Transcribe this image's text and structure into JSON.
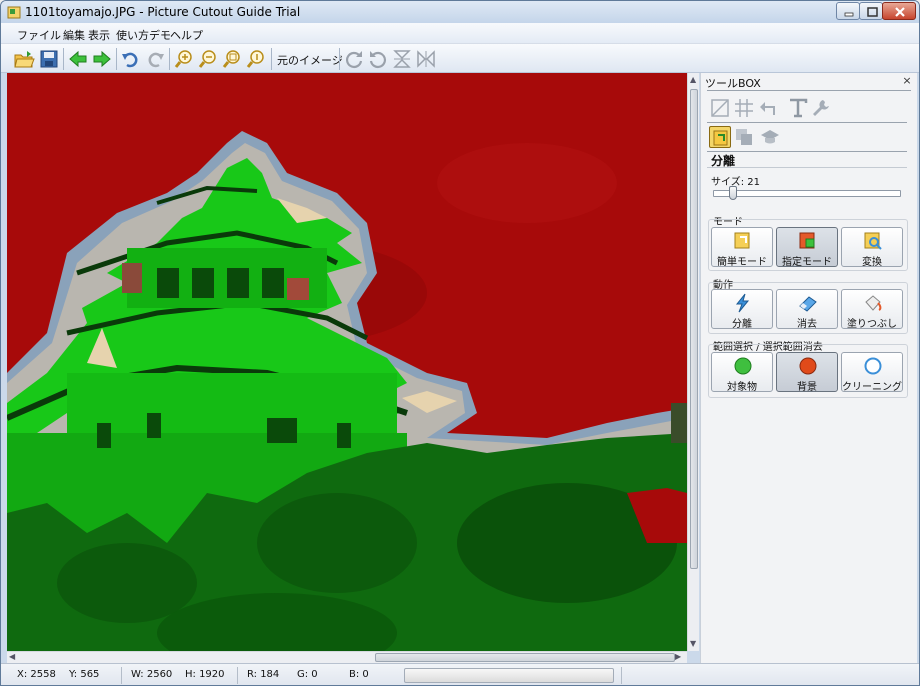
{
  "window": {
    "title": "1101toyamajo.JPG - Picture Cutout Guide Trial"
  },
  "menu": {
    "items": [
      "ファイル",
      "編集",
      "表示",
      "使い方デモ",
      "ヘルプ"
    ]
  },
  "toolbar": {
    "original_image_label": "元のイメージ",
    "icons": [
      "open-folder-icon",
      "save-icon",
      "back-arrow-icon",
      "forward-arrow-icon",
      "undo-icon",
      "redo-icon",
      "zoom-in-icon",
      "zoom-out-icon",
      "zoom-fit-icon",
      "zoom-actual-icon",
      "rotate-right-icon",
      "rotate-left-icon",
      "flip-vertical-icon",
      "flip-horizontal-icon"
    ]
  },
  "toolbox": {
    "title": "ツールBOX",
    "close_glyph": "×",
    "section_title": "分離",
    "size_label": "サイズ: 21",
    "size_value": 21,
    "mode": {
      "label": "モード",
      "buttons": [
        "簡単モード",
        "指定モード",
        "変換"
      ],
      "active": "指定モード"
    },
    "action": {
      "label": "動作",
      "buttons": [
        "分離",
        "消去",
        "塗りつぶし"
      ]
    },
    "range": {
      "label": "範囲選択 / 選択範囲消去",
      "buttons": [
        "対象物",
        "背景",
        "クリーニング"
      ],
      "active": "背景"
    },
    "colors": {
      "object_green": "#3fbf3f",
      "background_red": "#e04a1a",
      "cleaning_blue": "#3a8fd8"
    }
  },
  "canvas": {
    "overlay_colors": {
      "background": "#a70a0a",
      "object": "#18c818"
    }
  },
  "statusbar": {
    "x": "X: 2558",
    "y": "Y: 565",
    "w": "W: 2560",
    "h": "H: 1920",
    "r": "R: 184",
    "g": "G: 0",
    "b": "B: 0"
  }
}
